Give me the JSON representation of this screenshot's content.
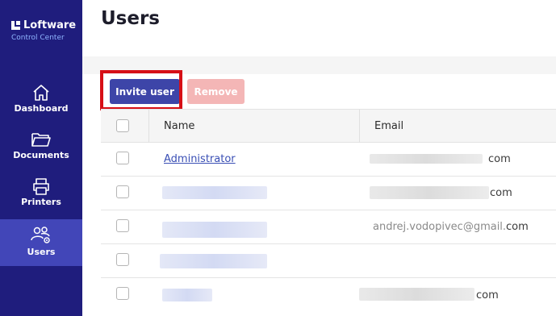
{
  "brand": {
    "name": "Loftware",
    "subtitle": "Control Center"
  },
  "sidebar": {
    "items": [
      {
        "label": "Dashboard",
        "icon": "home-icon"
      },
      {
        "label": "Documents",
        "icon": "folder-icon"
      },
      {
        "label": "Printers",
        "icon": "printer-icon"
      },
      {
        "label": "Users",
        "icon": "users-gear-icon",
        "active": true
      }
    ]
  },
  "page": {
    "title": "Users"
  },
  "toolbar": {
    "invite_label": "Invite user",
    "remove_label": "Remove"
  },
  "table": {
    "columns": {
      "name": "Name",
      "email": "Email"
    },
    "rows": [
      {
        "name": "Administrator",
        "email_visible": "com",
        "email_partial": ""
      },
      {
        "name": "",
        "email_visible": "com",
        "email_partial": ""
      },
      {
        "name": "",
        "email_visible": "com",
        "email_partial": "andrej.vodopivec@gmail."
      },
      {
        "name": "",
        "email_visible": "",
        "email_partial": ""
      },
      {
        "name": "",
        "email_visible": "com",
        "email_partial": ""
      }
    ]
  },
  "colors": {
    "sidebar": "#1f1d7d",
    "sidebar_active": "#4246b8",
    "primary_button": "#3d45a8",
    "remove_button_disabled": "#f4b6b6",
    "highlight_border": "#d60f16",
    "link": "#3a4fb5"
  }
}
